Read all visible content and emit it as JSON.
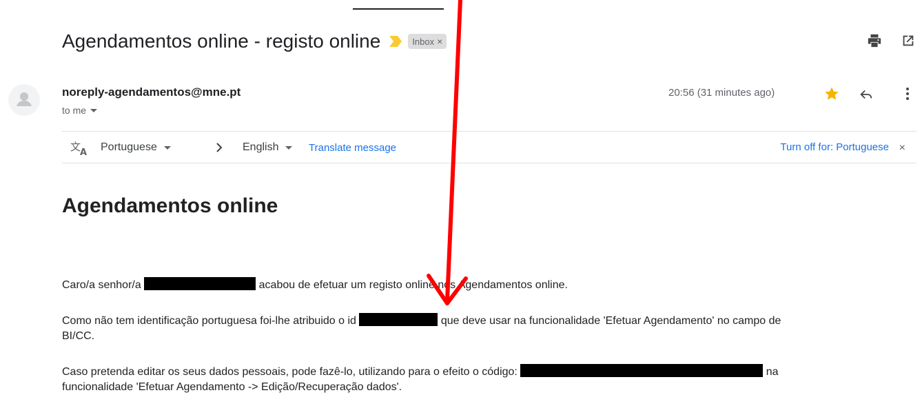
{
  "subject": {
    "title": "Agendamentos online - registo online",
    "label": "Inbox",
    "label_close": "×",
    "importance_color": "#f9cb33"
  },
  "toolbar": {
    "print_icon": "print-icon",
    "popout_icon": "open-in-new-window-icon"
  },
  "message": {
    "sender": "noreply-agendamentos@mne.pt",
    "to": "to me",
    "timestamp": "20:56 (31 minutes ago)",
    "starred": true,
    "star_color": "#f4b400"
  },
  "translate": {
    "from_lang": "Portuguese",
    "to_lang": "English",
    "translate_link": "Translate message",
    "turn_off": "Turn off for: Portuguese",
    "close": "×",
    "link_color": "#1a73e8"
  },
  "body": {
    "heading": "Agendamentos online",
    "p1_a": "Caro/a senhor/a",
    "p1_b": "acabou de efetuar um registo online nos Agendamentos online.",
    "p2_a": "Como não tem identificação portuguesa foi-lhe atribuido o id",
    "p2_b": "que deve usar na funcionalidade 'Efetuar Agendamento' no campo de",
    "p2_c": "BI/CC.",
    "p3_a": "Caso pretenda editar os seus dados pessoais, pode fazê-lo, utilizando para o efeito o código:",
    "p3_b": "na",
    "p3_c": "funcionalidade 'Efetuar Agendamento -> Edição/Recuperação dados'."
  },
  "annotation": {
    "arrow_color": "#ff0000"
  }
}
